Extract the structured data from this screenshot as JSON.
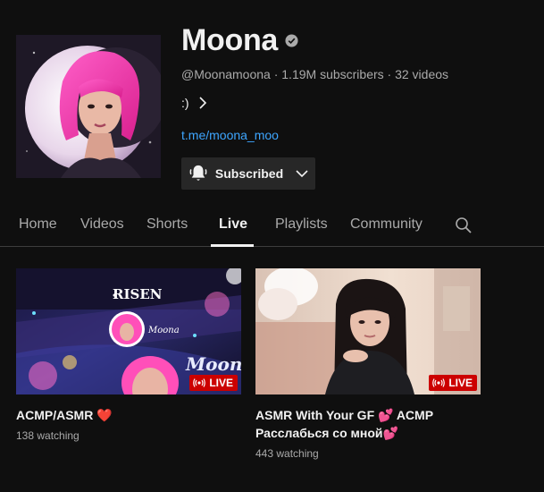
{
  "channel": {
    "name": "Moona",
    "handle": "@Moonamoona",
    "subscribers": "1.19M subscribers",
    "videos": "32 videos",
    "meta_line": "@Moonamoona · 1.19M subscribers · 32 videos",
    "description": ":)",
    "link": "t.me/moona_moo",
    "subscribe_label": "Subscribed",
    "avatar_icon": "channel-avatar"
  },
  "tabs": [
    {
      "label": "Home",
      "active": false
    },
    {
      "label": "Videos",
      "active": false
    },
    {
      "label": "Shorts",
      "active": false
    },
    {
      "label": "Live",
      "active": true
    },
    {
      "label": "Playlists",
      "active": false
    },
    {
      "label": "Community",
      "active": false
    }
  ],
  "videos": [
    {
      "title": "ACMP/ASMR ❤️",
      "meta": "138 watching",
      "badge": "LIVE",
      "thumbnail_text": "Moona",
      "thumbnail_logo": "RISEN"
    },
    {
      "title": "ASMR With Your GF 💕 ACMP Расслабься со мной💕",
      "meta": "443 watching",
      "badge": "LIVE"
    }
  ],
  "colors": {
    "background": "#0f0f0f",
    "link": "#3ea6ff",
    "live_badge": "#cc0000",
    "secondary_text": "#aaaaaa"
  }
}
